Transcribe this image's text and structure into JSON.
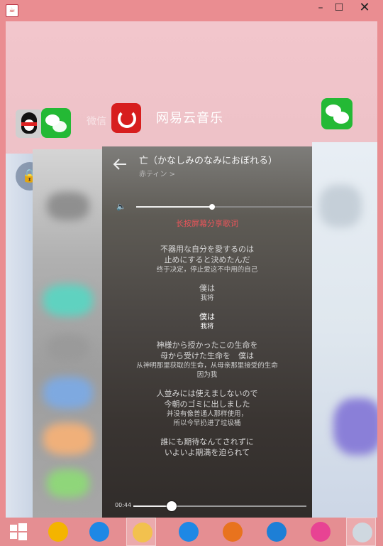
{
  "window": {
    "app_icon_glyph": "☕",
    "min_glyph": "–",
    "max_glyph": "☐",
    "close_glyph": "✕"
  },
  "header": {
    "faded_label": "微信",
    "app_title": "网易云音乐"
  },
  "player": {
    "song_title": "亡（かなしみのなみにおぼれる）",
    "artist": "赤ティン >",
    "volume_level": 0.43,
    "share_hint": "长按屏幕分享歌词",
    "lyrics": [
      {
        "active": false,
        "lines": [
          {
            "text": "不器用な自分を愛するのは",
            "trans": false
          },
          {
            "text": "止めにすると決めたんだ",
            "trans": false
          },
          {
            "text": "终于决定，停止爱这不中用的自己",
            "trans": true
          }
        ]
      },
      {
        "active": false,
        "lines": [
          {
            "text": "僕は",
            "trans": false
          },
          {
            "text": "我将",
            "trans": true
          }
        ]
      },
      {
        "active": true,
        "lines": [
          {
            "text": "僕は",
            "trans": false
          },
          {
            "text": "我将",
            "trans": true
          }
        ]
      },
      {
        "active": false,
        "lines": [
          {
            "text": "神様から授かったこの生命を",
            "trans": false
          },
          {
            "text": "母から受けた生命を　僕は",
            "trans": false
          },
          {
            "text": "从神明那里获取的生命，从母亲那里接受的生命",
            "trans": true
          },
          {
            "text": "因为我",
            "trans": true
          }
        ]
      },
      {
        "active": false,
        "lines": [
          {
            "text": "人並みには使えましないので",
            "trans": false
          },
          {
            "text": "今朝のゴミに出しました",
            "trans": false
          },
          {
            "text": "并没有像普通人那样使用，",
            "trans": true
          },
          {
            "text": "所以今早扔进了垃圾桶",
            "trans": true
          }
        ]
      },
      {
        "active": false,
        "lines": [
          {
            "text": "誰にも期待なんてされずに",
            "trans": false
          },
          {
            "text": "いよいよ期満を迫られて",
            "trans": false
          }
        ]
      }
    ],
    "current_time": "00:44",
    "progress": 0.22
  },
  "taskbar": {
    "items": [
      {
        "name": "start-button",
        "color": "#ffffff"
      },
      {
        "name": "taskbar-item-photos",
        "color": "#f4b400"
      },
      {
        "name": "taskbar-item-ie",
        "color": "#1e88e5"
      },
      {
        "name": "taskbar-item-explorer",
        "color": "#f2c14e"
      },
      {
        "name": "taskbar-item-ie2",
        "color": "#1e88e5"
      },
      {
        "name": "taskbar-item-firefox",
        "color": "#e8731e"
      },
      {
        "name": "taskbar-item-kugou",
        "color": "#1d7fd6"
      },
      {
        "name": "taskbar-item-colorful",
        "color": "#e84393"
      },
      {
        "name": "taskbar-item-avatar",
        "color": "#cfd8e0"
      }
    ]
  }
}
